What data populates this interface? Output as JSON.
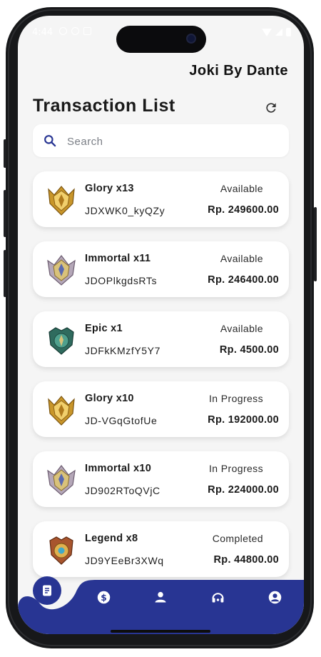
{
  "status_bar": {
    "time": "4:44"
  },
  "header": {
    "app_title": "Joki By Dante"
  },
  "page": {
    "title": "Transaction List"
  },
  "search": {
    "placeholder": "Search",
    "value": ""
  },
  "transactions": [
    {
      "name": "Glory x13",
      "code": "JDXWK0_kyQZy",
      "status": "Available",
      "price": "Rp. 249600.00",
      "rank_icon": "glory-rank-icon"
    },
    {
      "name": "Immortal x11",
      "code": "JDOPlkgdsRTs",
      "status": "Available",
      "price": "Rp. 246400.00",
      "rank_icon": "immortal-rank-icon"
    },
    {
      "name": "Epic x1",
      "code": "JDFkKMzfY5Y7",
      "status": "Available",
      "price": "Rp. 4500.00",
      "rank_icon": "epic-rank-icon"
    },
    {
      "name": "Glory x10",
      "code": "JD-VGqGtofUe",
      "status": "In Progress",
      "price": "Rp. 192000.00",
      "rank_icon": "glory-rank-icon"
    },
    {
      "name": "Immortal x10",
      "code": "JD902RToQVjC",
      "status": "In Progress",
      "price": "Rp. 224000.00",
      "rank_icon": "immortal-rank-icon"
    },
    {
      "name": "Legend x8",
      "code": "JD9YEeBr3XWq",
      "status": "Completed",
      "price": "Rp. 44800.00",
      "rank_icon": "legend-rank-icon"
    }
  ],
  "bottom_nav": {
    "active": "transactions-icon",
    "items": [
      "transactions-icon",
      "dollar-icon",
      "person-icon",
      "headset-icon",
      "profile-icon"
    ]
  },
  "colors": {
    "accent": "#283593",
    "background": "#f5f5f5",
    "card": "#ffffff",
    "text": "#1a1a1a"
  }
}
